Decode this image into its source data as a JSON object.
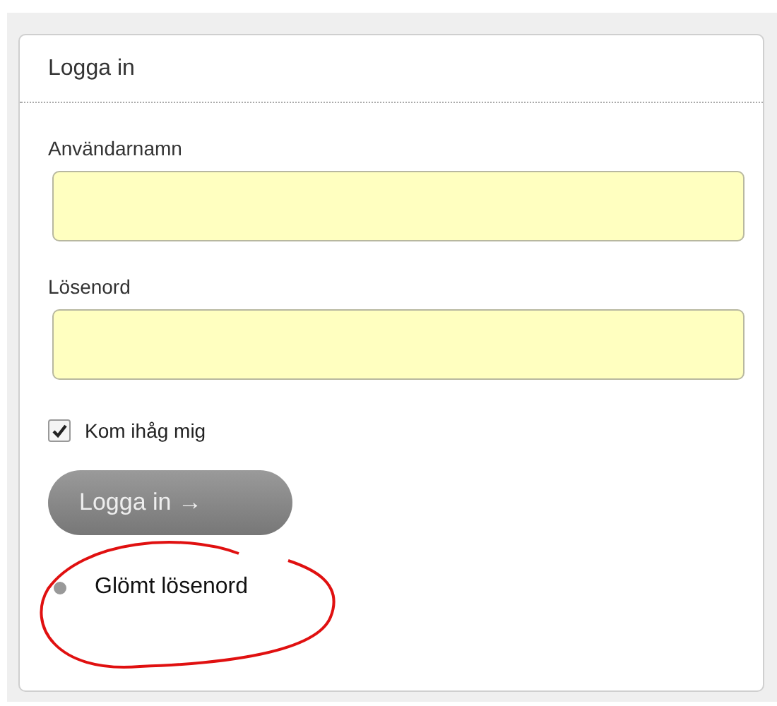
{
  "panel": {
    "title": "Logga in"
  },
  "fields": [
    {
      "label": "Användarnamn"
    },
    {
      "label": "Lösenord"
    }
  ],
  "remember": {
    "label": "Kom ihåg mig",
    "checked": true
  },
  "submit": {
    "label": "Logga in →"
  },
  "forgot": {
    "label": "Glömt lösenord",
    "circled": true
  }
}
